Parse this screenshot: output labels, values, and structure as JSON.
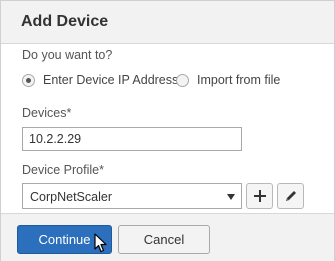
{
  "dialog": {
    "title": "Add Device"
  },
  "mode": {
    "question": "Do you want to?",
    "options": [
      {
        "label": "Enter Device IP Address",
        "selected": true
      },
      {
        "label": "Import from file",
        "selected": false
      }
    ]
  },
  "devices": {
    "label": "Devices*",
    "value": "10.2.2.29"
  },
  "profile": {
    "label": "Device Profile*",
    "selected": "CorpNetScaler"
  },
  "icons": {
    "add": "plus-icon",
    "edit": "pencil-icon",
    "dropdown": "chevron-down-icon",
    "cursor": "mouse-pointer-icon"
  },
  "buttons": {
    "continue_label": "Continue",
    "cancel_label": "Cancel"
  },
  "colors": {
    "primary": "#2b6fbd",
    "header_bg": "#f2f2f2"
  }
}
